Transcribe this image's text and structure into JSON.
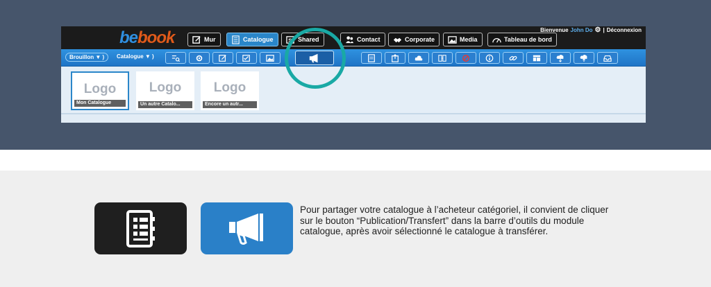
{
  "brand": {
    "part1": "be",
    "part2": "book"
  },
  "topnav": {
    "mur": "Mur",
    "catalogue": "Catalogue",
    "shared": "Shared",
    "contact": "Contact",
    "corporate": "Corporate",
    "media": "Media",
    "tableau": "Tableau de bord"
  },
  "user": {
    "welcome": "Bienvenue",
    "name": "John Do",
    "separator": "|",
    "logout": "Déconnexion"
  },
  "toolbar": {
    "draft": "Brouillon ▼ )",
    "catalogue": "Catalogue ▼ )"
  },
  "catalogs": [
    {
      "logo": "Logo",
      "name": "Mon Catalogue"
    },
    {
      "logo": "Logo",
      "name": "Un autre Catalo..."
    },
    {
      "logo": "Logo",
      "name": "Encore un autr..."
    }
  ],
  "colors": {
    "header_bg": "#46556b",
    "accent_blue": "#2a80c8",
    "highlight_teal": "#19a9a5"
  },
  "icons": {
    "catalog_icon": "catalog-book-icon",
    "publish_icon": "megaphone-icon"
  },
  "description": "Pour partager votre catalogue à l’acheteur catégoriel, il convient de cliquer sur le bouton “Publication/Transfert” dans la barre d’outils du module catalogue, après avoir sélectionné le catalogue à transférer."
}
